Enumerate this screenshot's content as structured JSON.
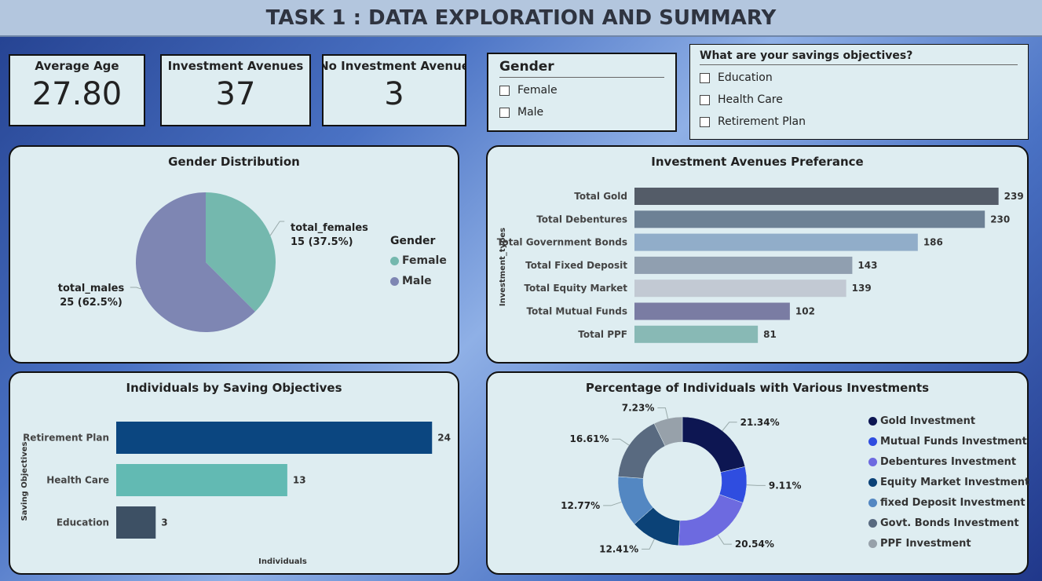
{
  "header": {
    "title": "TASK 1 : DATA EXPLORATION AND SUMMARY"
  },
  "kpis": [
    {
      "label": "Average Age",
      "value": "27.80"
    },
    {
      "label": "Investment Avenues",
      "value": "37"
    },
    {
      "label": "No Investment Avenue",
      "value": "3"
    }
  ],
  "gender_slicer": {
    "title": "Gender",
    "options": [
      "Female",
      "Male"
    ]
  },
  "objectives_slicer": {
    "title": "What are your savings objectives?",
    "options": [
      "Education",
      "Health Care",
      "Retirement Plan"
    ]
  },
  "colors": {
    "female": "#74b8ae",
    "male": "#7e86b3",
    "navy": "#0b4680",
    "teal": "#62bab3",
    "slate": "#3d5064"
  },
  "chart_data": [
    {
      "type": "pie",
      "title": "Gender Distribution",
      "legend_title": "Gender",
      "legend_position": "right",
      "slices": [
        {
          "name": "total_females",
          "value": 15,
          "label": "15 (37.5%)",
          "legend": "Female",
          "color": "#74b8ae"
        },
        {
          "name": "total_males",
          "value": 25,
          "label": "25 (62.5%)",
          "legend": "Male",
          "color": "#7e86b3"
        }
      ]
    },
    {
      "type": "bar",
      "orientation": "horizontal",
      "title": "Investment Avenues Preferance",
      "ylabel": "Investment_types",
      "categories": [
        "Total Gold",
        "Total Debentures",
        "Total Government Bonds",
        "Total Fixed Deposit",
        "Total Equity Market",
        "Total Mutual Funds",
        "Total PPF"
      ],
      "values": [
        239,
        230,
        186,
        143,
        139,
        102,
        81
      ],
      "colors": [
        "#545c68",
        "#6d8195",
        "#91adc9",
        "#909fb0",
        "#c2c9d3",
        "#7a7ca3",
        "#88b9b5"
      ],
      "xlim": [
        0,
        250
      ],
      "grid": false
    },
    {
      "type": "bar",
      "orientation": "horizontal",
      "title": "Individuals by Saving Objectives",
      "xlabel": "Individuals",
      "ylabel": "Saving Objectives",
      "categories": [
        "Retirement Plan",
        "Health Care",
        "Education"
      ],
      "values": [
        24,
        13,
        3
      ],
      "colors": [
        "#0b4680",
        "#62bab3",
        "#3d5064"
      ],
      "xlim": [
        0,
        25
      ],
      "grid": false
    },
    {
      "type": "pie",
      "donut": true,
      "title": "Percentage of Individuals with Various Investments",
      "legend_position": "right",
      "slices": [
        {
          "name": "Gold Investment",
          "value": 21.34,
          "label": "21.34%",
          "color": "#0d1652"
        },
        {
          "name": "Mutual Funds Investment",
          "value": 9.11,
          "label": "9.11%",
          "color": "#2f4de0"
        },
        {
          "name": "Debentures Investment",
          "value": 20.54,
          "label": "20.54%",
          "color": "#6d6ae0"
        },
        {
          "name": "Equity Market Investment",
          "value": 12.41,
          "label": "12.41%",
          "color": "#0b4277"
        },
        {
          "name": "fixed Deposit Investment",
          "value": 12.77,
          "label": "12.77%",
          "color": "#5387c2"
        },
        {
          "name": "Govt. Bonds Investment",
          "value": 16.61,
          "label": "16.61%",
          "color": "#596a80"
        },
        {
          "name": "PPF Investment",
          "value": 7.23,
          "label": "7.23%",
          "color": "#97a1aa"
        }
      ]
    }
  ]
}
